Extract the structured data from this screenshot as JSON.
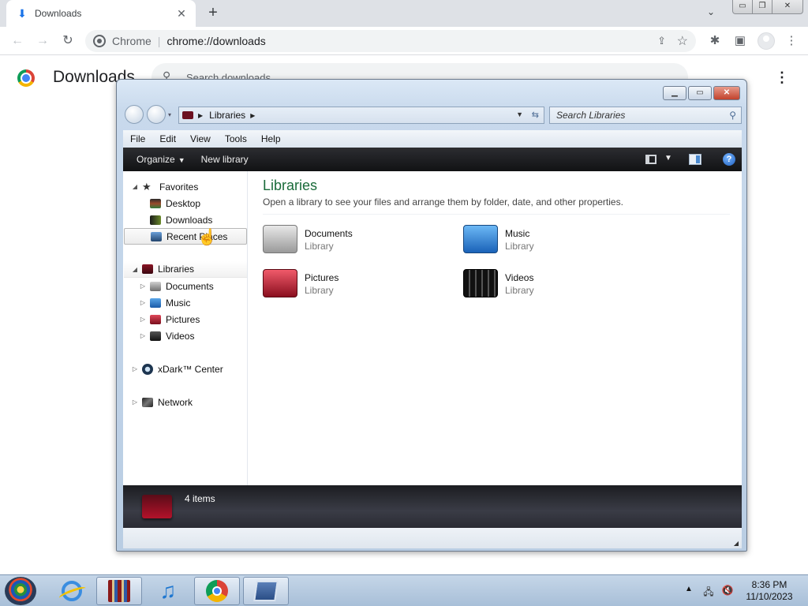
{
  "chrome": {
    "tab_title": "Downloads",
    "tab_close": "✕",
    "new_tab": "+",
    "site_label": "Chrome",
    "url": "chrome://downloads",
    "page_title": "Downloads",
    "search_placeholder": "Search downloads",
    "more": "⋮"
  },
  "explorer": {
    "address": {
      "crumb": "Libraries"
    },
    "search_placeholder": "Search Libraries",
    "menu": [
      "File",
      "Edit",
      "View",
      "Tools",
      "Help"
    ],
    "commands": {
      "organize": "Organize",
      "new_library": "New library"
    },
    "nav": {
      "favorites": "Favorites",
      "desktop": "Desktop",
      "downloads": "Downloads",
      "recent_places": "Recent Places",
      "libraries": "Libraries",
      "documents": "Documents",
      "music": "Music",
      "pictures": "Pictures",
      "videos": "Videos",
      "xdark": "xDark™ Center",
      "network": "Network"
    },
    "content": {
      "title": "Libraries",
      "description": "Open a library to see your files and arrange them by folder, date, and other properties.",
      "libraries": [
        {
          "name": "Documents",
          "type": "Library"
        },
        {
          "name": "Music",
          "type": "Library"
        },
        {
          "name": "Pictures",
          "type": "Library"
        },
        {
          "name": "Videos",
          "type": "Library"
        }
      ]
    },
    "status": {
      "count": "4 items"
    }
  },
  "taskbar": {
    "time": "8:36 PM",
    "date": "11/10/2023"
  }
}
